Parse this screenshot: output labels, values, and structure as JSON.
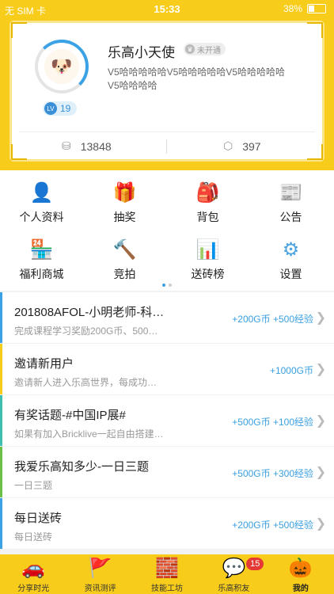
{
  "status_bar": {
    "carrier": "无 SIM 卡",
    "wifi": "wifi-icon",
    "time": "15:33",
    "battery": "38%"
  },
  "profile": {
    "username": "乐高小天使",
    "vip_status": "未开通",
    "signature": "V5哈哈哈哈哈V5哈哈哈哈哈V5哈哈哈哈哈V5哈哈哈哈",
    "level": "19",
    "coins": "13848",
    "bricks": "397"
  },
  "grid": [
    {
      "label": "个人资料",
      "icon": "person-icon",
      "color": "#4aa3df"
    },
    {
      "label": "抽奖",
      "icon": "gift-icon",
      "color": "#e55a4e"
    },
    {
      "label": "背包",
      "icon": "bag-icon",
      "color": "#6cc04a"
    },
    {
      "label": "公告",
      "icon": "notice-icon",
      "color": "#4aa3df"
    },
    {
      "label": "福利商城",
      "icon": "shop-icon",
      "color": "#3fbfb0"
    },
    {
      "label": "竞拍",
      "icon": "gavel-icon",
      "color": "#4aa3df"
    },
    {
      "label": "送砖榜",
      "icon": "ranking-icon",
      "color": "#e55a4e"
    },
    {
      "label": "设置",
      "icon": "settings-icon",
      "color": "#4aa3df"
    }
  ],
  "tasks": [
    {
      "title": "201808AFOL-小明老师-科…",
      "desc": "完成课程学习奖励200G币、500…",
      "reward": "+200G币 +500经验",
      "color": "#3ba2e5"
    },
    {
      "title": "邀请新用户",
      "desc": "邀请新人进入乐高世界，每成功…",
      "reward": "+1000G币",
      "color": "#f7cc1a"
    },
    {
      "title": "有奖话题-#中国IP展#",
      "desc": "如果有加入Bricklive一起自由搭建…",
      "reward": "+500G币 +100经验",
      "color": "#3fbfb0"
    },
    {
      "title": "我爱乐高知多少-一日三题",
      "desc": "一日三题",
      "reward": "+500G币 +300经验",
      "color": "#6cc04a"
    },
    {
      "title": "每日送砖",
      "desc": "每日送砖",
      "reward": "+200G币 +500经验",
      "color": "#3ba2e5"
    }
  ],
  "tabbar": [
    {
      "label": "分享时光",
      "icon": "car-icon"
    },
    {
      "label": "资讯测评",
      "icon": "flag-icon"
    },
    {
      "label": "技能工坊",
      "icon": "bricks-icon"
    },
    {
      "label": "乐高积友",
      "icon": "chat-icon",
      "badge": "15"
    },
    {
      "label": "我的",
      "icon": "minifigure-icon"
    }
  ]
}
